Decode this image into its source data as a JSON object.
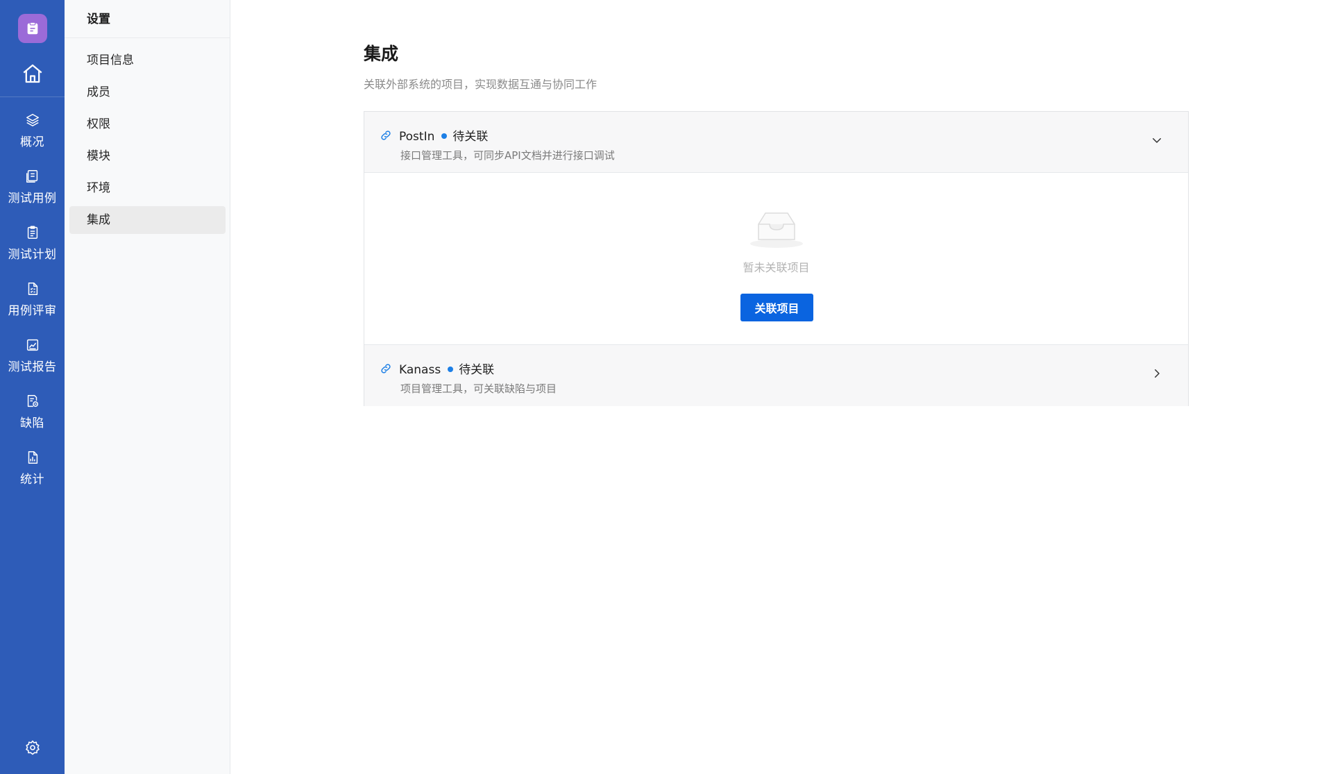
{
  "rail": {
    "logo_icon": "clipboard-icon",
    "home_icon": "home-icon",
    "items": [
      {
        "label": "概况",
        "icon": "layers-icon"
      },
      {
        "label": "测试用例",
        "icon": "document-list-icon"
      },
      {
        "label": "测试计划",
        "icon": "clipboard-list-icon"
      },
      {
        "label": "用例评审",
        "icon": "file-check-icon"
      },
      {
        "label": "测试报告",
        "icon": "chart-line-icon"
      },
      {
        "label": "缺陷",
        "icon": "bug-file-icon"
      },
      {
        "label": "统计",
        "icon": "bar-chart-icon"
      }
    ],
    "settings_icon": "gear-icon",
    "accent": "#2e5cb8",
    "logo_color": "#9b6bd8"
  },
  "sidebar": {
    "title": "设置",
    "items": [
      {
        "label": "项目信息"
      },
      {
        "label": "成员"
      },
      {
        "label": "权限"
      },
      {
        "label": "模块"
      },
      {
        "label": "环境"
      },
      {
        "label": "集成",
        "active": true
      }
    ]
  },
  "main": {
    "title": "集成",
    "description": "关联外部系统的项目，实现数据互通与协同工作",
    "integrations": [
      {
        "name": "PostIn",
        "status": "待关联",
        "subtitle": "接口管理工具，可同步API文档并进行接口调试",
        "expanded": true,
        "empty_text": "暂未关联项目",
        "button_label": "关联项目"
      },
      {
        "name": "Kanass",
        "status": "待关联",
        "subtitle": "项目管理工具，可关联缺陷与项目",
        "expanded": false
      }
    ],
    "primary_color": "#0a64e0",
    "status_dot_color": "#1c7fe6"
  }
}
